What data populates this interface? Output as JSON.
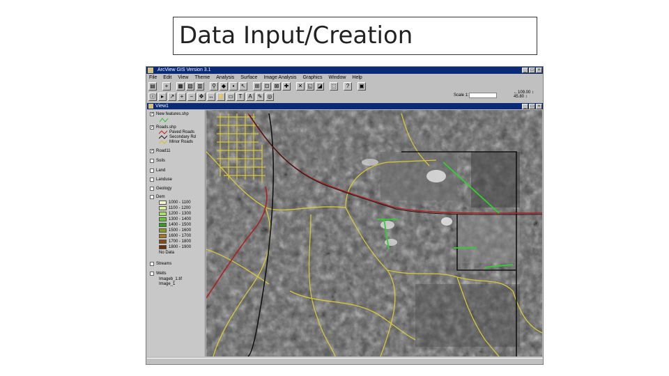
{
  "slide": {
    "title": "Data Input/Creation"
  },
  "app": {
    "title": "ArcView GIS Version 3.1",
    "window_buttons": [
      "_",
      "□",
      "×"
    ],
    "menu": [
      "File",
      "Edit",
      "View",
      "Theme",
      "Analysis",
      "Surface",
      "Image Analysis",
      "Graphics",
      "Window",
      "Help"
    ],
    "toolbar1_icons": [
      "save-icon",
      "add-theme-icon",
      "theme-properties-icon",
      "edit-legend-icon",
      "open-table-icon",
      "find-icon",
      "locate-icon",
      "query-builder-icon",
      "map-query-icon",
      "zoom-full-icon",
      "zoom-active-icon",
      "zoom-selected-icon",
      "zoom-in-icon",
      "zoom-out-icon",
      "zoom-previous-icon",
      "select-features-icon",
      "clear-selection-icon",
      "help-icon",
      "layout-icon"
    ],
    "toolbar2_icons": [
      "identify-icon",
      "pointer-icon",
      "vertex-edit-icon",
      "zoom-in-tool-icon",
      "zoom-out-tool-icon",
      "pan-icon",
      "measure-icon",
      "hotlink-icon",
      "area-of-interest-icon",
      "label-icon",
      "text-icon",
      "draw-icon",
      "snap-icon"
    ],
    "scale_label": "Scale 1:",
    "scale_value": "",
    "coords": [
      "←109.00 ↕",
      "45.80 ↕"
    ],
    "colors": {
      "titlebar": "#0a2a78",
      "chrome": "#c0c0c0"
    }
  },
  "view": {
    "title": "View1",
    "themes": [
      {
        "label": "New features.shp",
        "checked": true
      },
      {
        "label": "Roads.shp",
        "checked": true
      },
      {
        "label": "Road11",
        "checked": true
      },
      {
        "label": "Soils",
        "checked": false
      },
      {
        "label": "Land",
        "checked": false
      },
      {
        "label": "Landuse",
        "checked": false
      },
      {
        "label": "Geology",
        "checked": false
      },
      {
        "label": "Dem",
        "checked": false
      },
      {
        "label": "Streams",
        "checked": false
      },
      {
        "label": "Wells",
        "checked": false
      }
    ],
    "road_legend": [
      "Paved Roads",
      "Secondary Rd",
      "Minor Roads"
    ],
    "dem_legend": [
      {
        "range": "1000 - 1100",
        "color": "#f4f8c8"
      },
      {
        "range": "1100 - 1200",
        "color": "#d8f090"
      },
      {
        "range": "1200 - 1300",
        "color": "#a8e060"
      },
      {
        "range": "1300 - 1400",
        "color": "#60c830"
      },
      {
        "range": "1400 - 1500",
        "color": "#3a9a20"
      },
      {
        "range": "1500 - 1600",
        "color": "#8a9a18"
      },
      {
        "range": "1600 - 1700",
        "color": "#a87818"
      },
      {
        "range": "1700 - 1800",
        "color": "#8a4a10"
      },
      {
        "range": "1800 - 1900",
        "color": "#6a3008"
      },
      {
        "range": "No Data",
        "color": "#c8c8c8"
      }
    ],
    "wells_legend": [
      "Imageb_1.tif",
      "Image_1"
    ]
  }
}
